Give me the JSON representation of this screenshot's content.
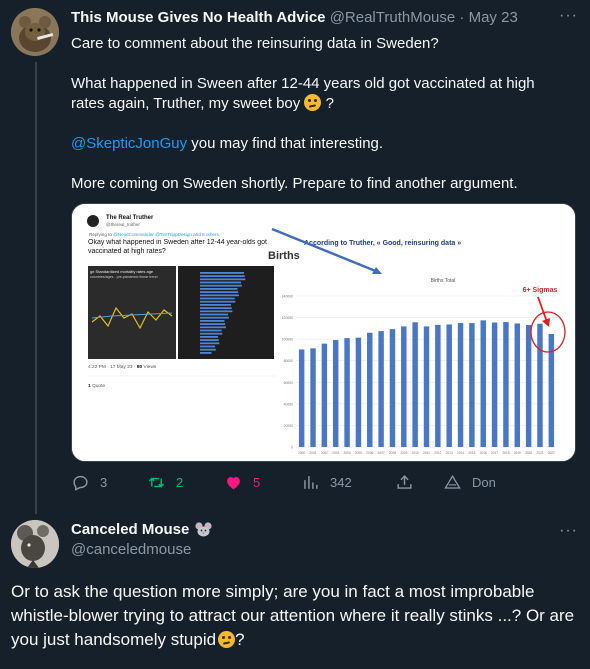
{
  "tweet1": {
    "display_name": "This Mouse Gives No Health Advice",
    "handle": "@RealTruthMouse",
    "separator": "·",
    "date": "May 23",
    "more_icon": "more-dots-icon",
    "line1": "Care to comment about the reinsuring data in Sweden?",
    "line2": "What happened in Sween after 12-44 years old got vaccinated at high rates again, Truther, my sweet boy",
    "line2_suffix": " ?",
    "mention": "@SkepticJonGuy",
    "line3_suffix": " you may find that interesting.",
    "line4": "More coming on Sweden shortly. Prepare to find another argument.",
    "media": {
      "quote_card": {
        "name": "The Real Truther",
        "handle": "@thereal_truther",
        "replying_prefix": "Replying to",
        "replying_mentions": "@NeoitCommander @TimTrippDesign and 5 others",
        "text": "Okay what happened in Sweden after 12-44 year-olds got vaccinated at high rates?",
        "inner_chart_title": "ge Standardized mortality rates age",
        "inner_chart_subtitle": "countries/ages - pre-pandemic linear trend",
        "inner_meta_time": "4:22 PM · 17 May 23 ·",
        "inner_meta_views": "80",
        "inner_meta_views_label": " Views",
        "inner_quote_count": "1",
        "inner_quote_label": " Quote"
      },
      "annotation": "According to Truther, « Good, reinsuring data »",
      "births_label": "Births",
      "sigma_label": "6+ Sigmas",
      "chart_data": {
        "type": "bar",
        "title": "Births Total",
        "categories": [
          "2000",
          "2001",
          "2002",
          "2003",
          "2004",
          "2005",
          "2006",
          "2007",
          "2008",
          "2009",
          "2010",
          "2011",
          "2012",
          "2013",
          "2014",
          "2015",
          "2016",
          "2017",
          "2018",
          "2019",
          "2020",
          "2021",
          "2022"
        ],
        "values": [
          90441,
          91466,
          95815,
          99157,
          100928,
          101346,
          105913,
          107421,
          109301,
          111801,
          115641,
          111770,
          113177,
          113593,
          114907,
          114870,
          117425,
          115416,
          115832,
          114523,
          113077,
          114263,
          104734
        ],
        "ylim": [
          0,
          140000
        ],
        "yticks": [
          "0",
          "20000",
          "40000",
          "60000",
          "80000",
          "100000",
          "120000",
          "140000"
        ],
        "grid": true,
        "bar_color": "#4a76c6"
      }
    },
    "actions": {
      "reply_count": "3",
      "retweet_count": "2",
      "like_count": "5",
      "views_count": "342",
      "translate_label": "Don",
      "colors": {
        "retweet": "#00ba7c",
        "like": "#f91880",
        "muted": "#8b98a5"
      }
    }
  },
  "tweet2": {
    "display_name": "Canceled Mouse",
    "name_emoji": "mouse-face-icon",
    "handle": "@canceledmouse",
    "more_icon": "more-dots-icon",
    "text": "Or to ask the question more simply; are you in fact a most improbable whistle-blower trying to attract our attention where it really stinks ...? Or are you just handsomely stupid",
    "text_suffix": "?"
  }
}
